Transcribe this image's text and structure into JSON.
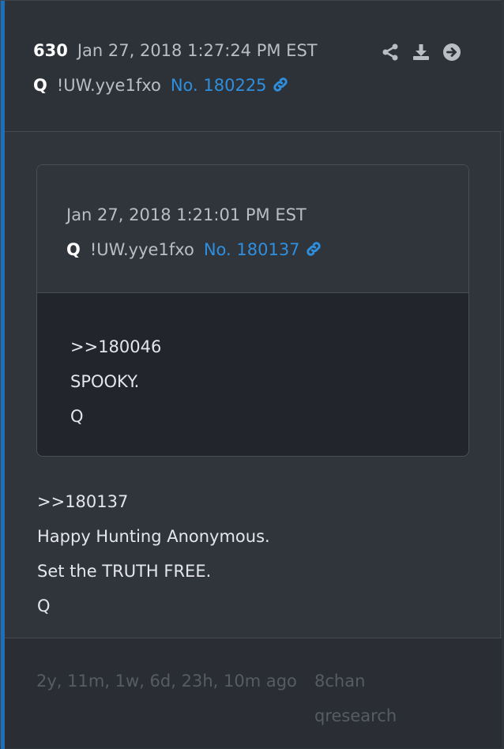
{
  "post": {
    "number": "630",
    "date": "Jan 27, 2018 1:27:24 PM EST",
    "author": "Q",
    "tripcode": "!UW.yye1fxo",
    "post_id": "No. 180225",
    "lines": [
      ">>180137",
      "Happy Hunting Anonymous.",
      "Set the TRUTH FREE.",
      "Q"
    ]
  },
  "actions": [
    {
      "icon": "share-icon"
    },
    {
      "icon": "download-icon"
    },
    {
      "icon": "arrow-right-circle-icon"
    }
  ],
  "quoted": {
    "date": "Jan 27, 2018 1:21:01 PM EST",
    "author": "Q",
    "tripcode": "!UW.yye1fxo",
    "post_id": "No. 180137",
    "lines": [
      ">>180046",
      "SPOOKY.",
      "Q"
    ]
  },
  "footer": {
    "ago": "2y, 11m, 1w, 6d, 23h, 10m ago",
    "source_line1": "8chan",
    "source_line2": "qresearch"
  },
  "colors": {
    "accent": "#1c6fb8",
    "link": "#2f8fdf",
    "background": "#30343b"
  }
}
